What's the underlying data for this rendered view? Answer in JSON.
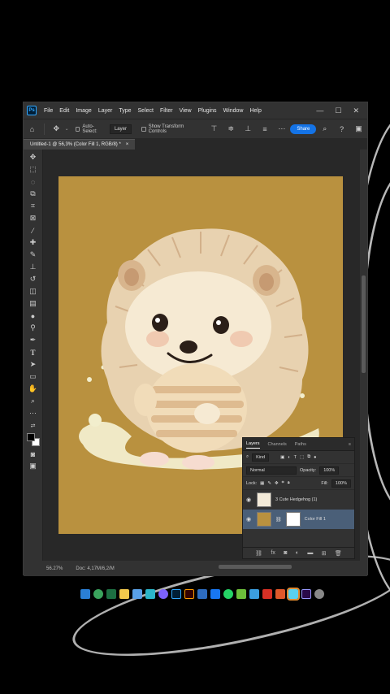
{
  "menubar": {
    "app_icon": "Ps",
    "items": [
      "File",
      "Edit",
      "Image",
      "Layer",
      "Type",
      "Select",
      "Filter",
      "View",
      "Plugins",
      "Window",
      "Help"
    ],
    "min_icon": "—",
    "max_icon": "☐",
    "close_icon": "✕"
  },
  "options": {
    "auto_select_label": "Auto-Select:",
    "auto_select_value": "Layer",
    "transform_label": "Show Transform Controls",
    "share_label": "Share"
  },
  "tab": {
    "title": "Untitled-1 @ 56,3% (Color Fill 1, RGB/8) *",
    "close": "×"
  },
  "status": {
    "zoom": "56.27%",
    "doc": "Doc: 4,17M/6,2/M"
  },
  "layers_panel": {
    "tabs": [
      "Layers",
      "Channels",
      "Paths"
    ],
    "filter_value": "Kind",
    "blend_mode": "Normal",
    "opacity_label": "Opacity:",
    "opacity_value": "100%",
    "lock_label": "Lock:",
    "fill_label": "Fill:",
    "fill_value": "100%",
    "layers": [
      {
        "name": "3 Cute Hedgehog (1)",
        "selected": false
      },
      {
        "name": "Color Fill 1",
        "selected": true
      }
    ]
  },
  "colors": {
    "canvas_fill": "#b9913f",
    "selection": "#4a5f78",
    "share": "#1473e6"
  }
}
